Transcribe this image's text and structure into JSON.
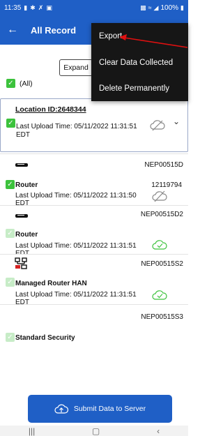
{
  "status_bar": {
    "time": "11:35",
    "battery": "100%",
    "left_icons": [
      "message-icon",
      "settings-icon",
      "missed-call-icon",
      "app-icon"
    ],
    "right_icons": [
      "nfc-icon",
      "wifi-icon",
      "signal-icon"
    ]
  },
  "app_bar": {
    "back_icon": "back-arrow-icon",
    "title": "All Record"
  },
  "overflow_menu": {
    "items": [
      "Export",
      "Clear Data Collected",
      "Delete Permanently"
    ]
  },
  "filter": {
    "expand_label": "Expand",
    "all_label": "(All)",
    "all_checked": true
  },
  "location": {
    "title": "Location ID:2648344",
    "upload_time": "Last Upload Time: 05/11/2022 11:31:51 EDT",
    "checked": true,
    "cloud_status": "not-synced"
  },
  "devices": [
    {
      "code": "NEP00515D",
      "name": "Router",
      "serial": "12119794",
      "upload_time": "Last Upload Time: 05/11/2022 11:31:50 EDT",
      "checked": true,
      "icon": "router-icon",
      "cloud_status": "not-synced"
    },
    {
      "code": "NEP00515D2",
      "name": "Router",
      "serial": "",
      "upload_time": "Last Upload Time: 05/11/2022 11:31:51 EDT",
      "checked": false,
      "icon": "router-icon",
      "cloud_status": "synced"
    },
    {
      "code": "NEP00515S2",
      "name": "Managed Router HAN",
      "serial": "",
      "upload_time": "Last Upload Time: 05/11/2022 11:31:51 EDT",
      "checked": false,
      "icon": "managed-router-icon",
      "cloud_status": "synced"
    },
    {
      "code": "NEP00515S3",
      "name": "Standard Security",
      "serial": "",
      "upload_time": "",
      "checked": false,
      "icon": "",
      "cloud_status": ""
    }
  ],
  "submit": {
    "label": "Submit Data to Server",
    "icon": "cloud-upload-icon"
  },
  "nav_bar": {
    "recent_icon": "recent-apps-icon",
    "home_icon": "home-icon",
    "back_icon": "back-icon"
  },
  "colors": {
    "primary": "#1f5fc6",
    "check_green": "#3cc23c",
    "synced_green": "#3cc23c",
    "menu_bg": "#161616",
    "annotation_red": "#e01010"
  }
}
